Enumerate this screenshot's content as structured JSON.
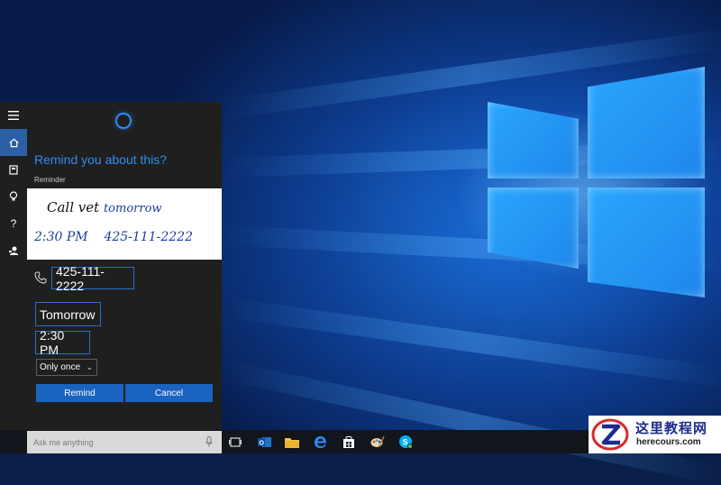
{
  "rail": {
    "items": [
      {
        "icon": "hamburger-icon"
      },
      {
        "icon": "home-icon",
        "active": true
      },
      {
        "icon": "notebook-icon"
      },
      {
        "icon": "lightbulb-icon"
      },
      {
        "icon": "help-icon",
        "glyph": "?"
      },
      {
        "icon": "feedback-icon"
      }
    ]
  },
  "cortana": {
    "question": "Remind you about this?",
    "section_label": "Reminder",
    "handwritten_note": {
      "line1": [
        "Call vet",
        "tomorrow"
      ],
      "line2": "2:30 PM    425-111-2222"
    },
    "phone": "425-111-2222",
    "date": "Tomorrow",
    "time": "2:30 PM",
    "frequency": "Only once",
    "remind_label": "Remind",
    "cancel_label": "Cancel"
  },
  "taskbar": {
    "search_placeholder": "Ask me anything",
    "apps": [
      "task-view-icon",
      "outlook-icon",
      "file-explorer-icon",
      "edge-icon",
      "store-icon",
      "paint-icon",
      "skype-icon"
    ]
  },
  "watermark": {
    "title": "这里教程网",
    "url": "herecours.com"
  },
  "colors": {
    "accent": "#2e8df0",
    "button": "#1a64c0",
    "panel": "#1f1f1f",
    "field_border": "#2b6fc8"
  }
}
